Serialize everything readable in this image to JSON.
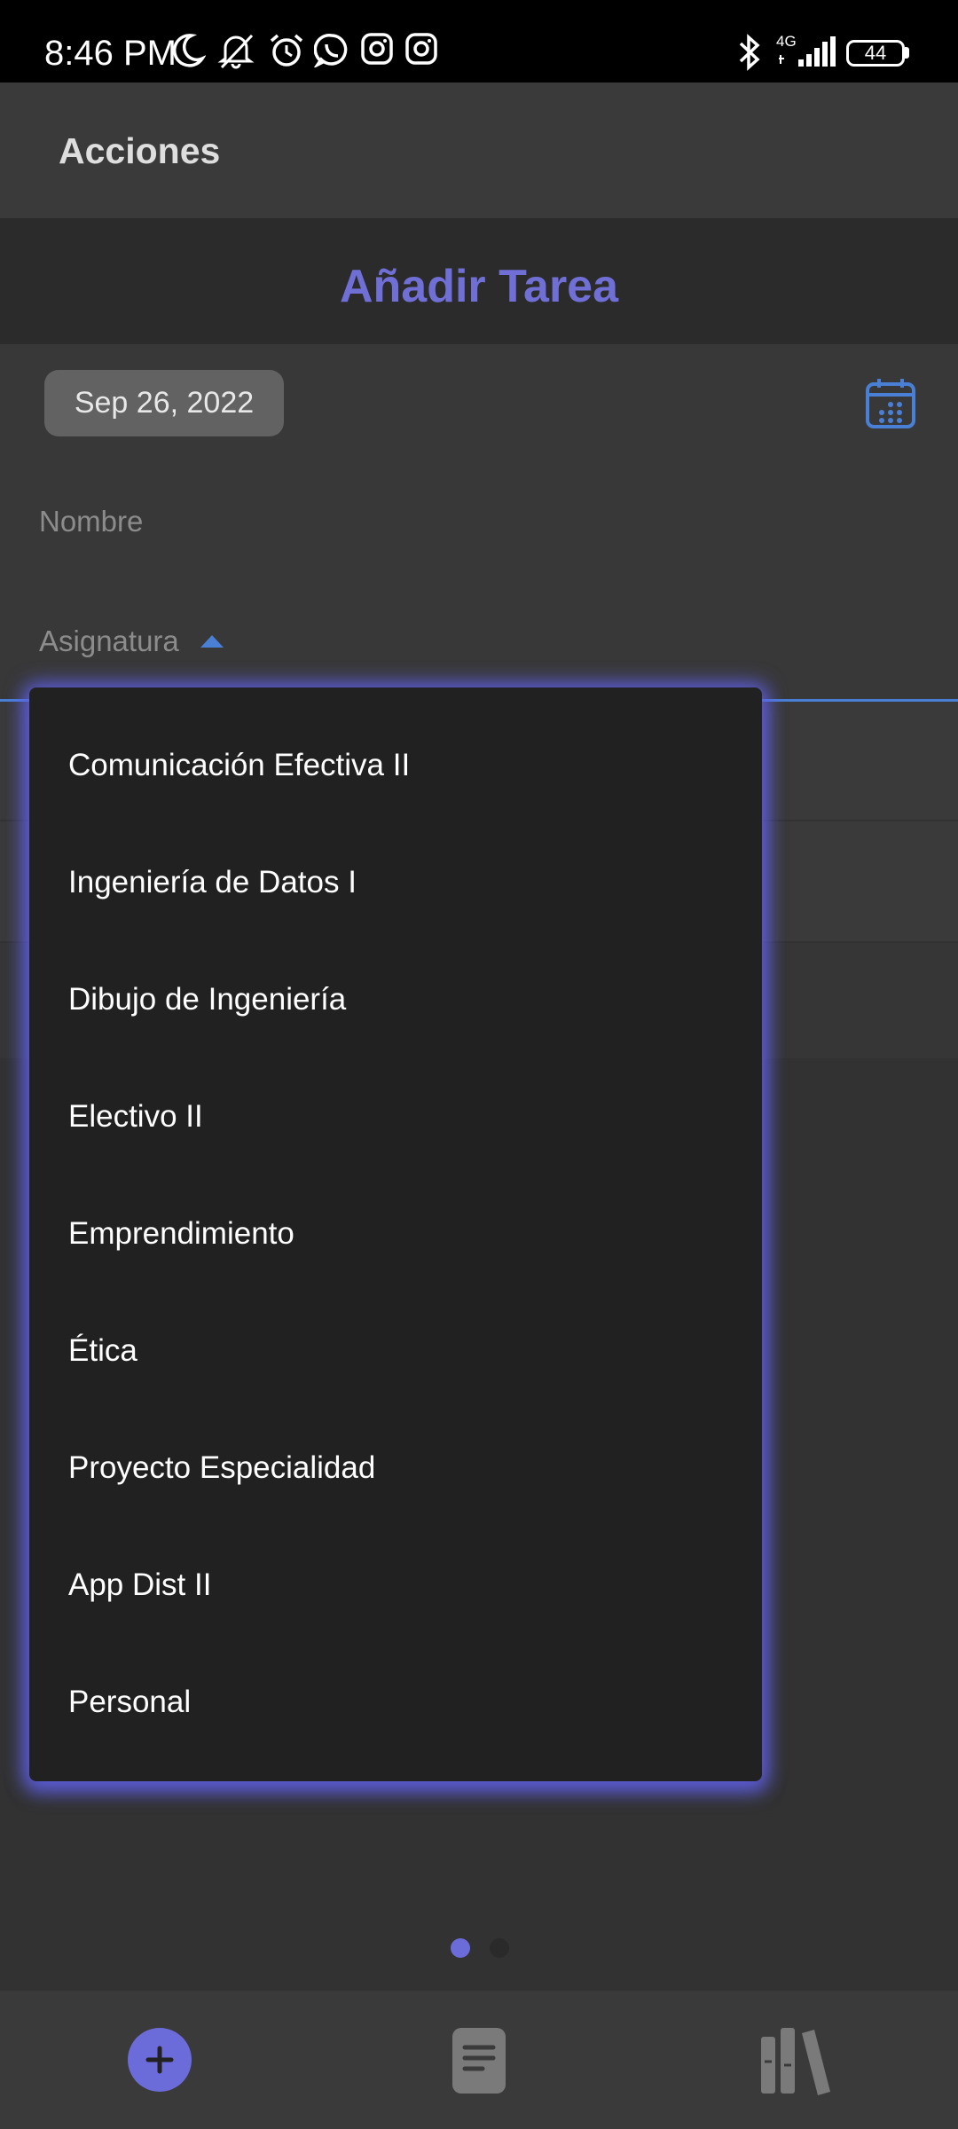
{
  "status_bar": {
    "time": "8:46 PM",
    "network": "4G",
    "battery": "44",
    "icons": [
      "moon-icon",
      "mute-icon",
      "alarm-icon",
      "whatsapp-icon",
      "instagram-icon",
      "instagram-icon",
      "bluetooth-icon",
      "signal-icon",
      "battery-icon"
    ]
  },
  "app_bar": {
    "title": "Acciones"
  },
  "form": {
    "title": "Añadir Tarea",
    "date": "Sep 26, 2022",
    "name_placeholder": "Nombre",
    "subject_label": "Asignatura"
  },
  "dropdown": {
    "items": [
      "Comunicación Efectiva II",
      "Ingeniería de Datos I",
      "Dibujo de Ingeniería",
      "Electivo II",
      "Emprendimiento",
      "Ética",
      "Proyecto Especialidad",
      "App Dist II",
      "Personal"
    ]
  },
  "page_indicator": {
    "current": 1,
    "total": 2
  },
  "bottom_nav": {
    "items": [
      "add-task-icon",
      "document-icon",
      "library-icon"
    ]
  },
  "colors": {
    "accent": "#6b6bd9",
    "focus": "#4a7fd6",
    "background": "#323232"
  }
}
